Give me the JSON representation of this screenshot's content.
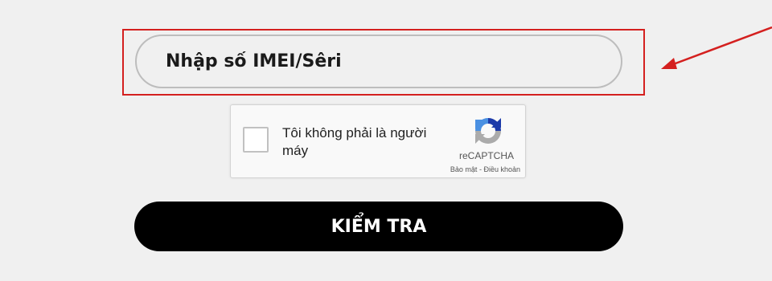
{
  "form": {
    "imei_placeholder": "Nhập số IMEI/Sêri",
    "imei_value": ""
  },
  "captcha": {
    "label": "Tôi không phải là người máy",
    "brand": "reCAPTCHA",
    "privacy_link": "Bảo mật",
    "separator": "-",
    "terms_link": "Điều khoản",
    "logo_icon": "recaptcha-icon"
  },
  "submit": {
    "label": "KIỂM TRA"
  },
  "annotation": {
    "highlight_color": "#d4201f",
    "arrow_icon": "arrow-left-icon"
  },
  "colors": {
    "background": "#f0f0f0",
    "button_bg": "#000000",
    "button_text": "#ffffff",
    "recaptcha_blue": "#1c3aa9",
    "recaptcha_light_blue": "#4a90e2",
    "recaptcha_gray": "#ababab"
  }
}
